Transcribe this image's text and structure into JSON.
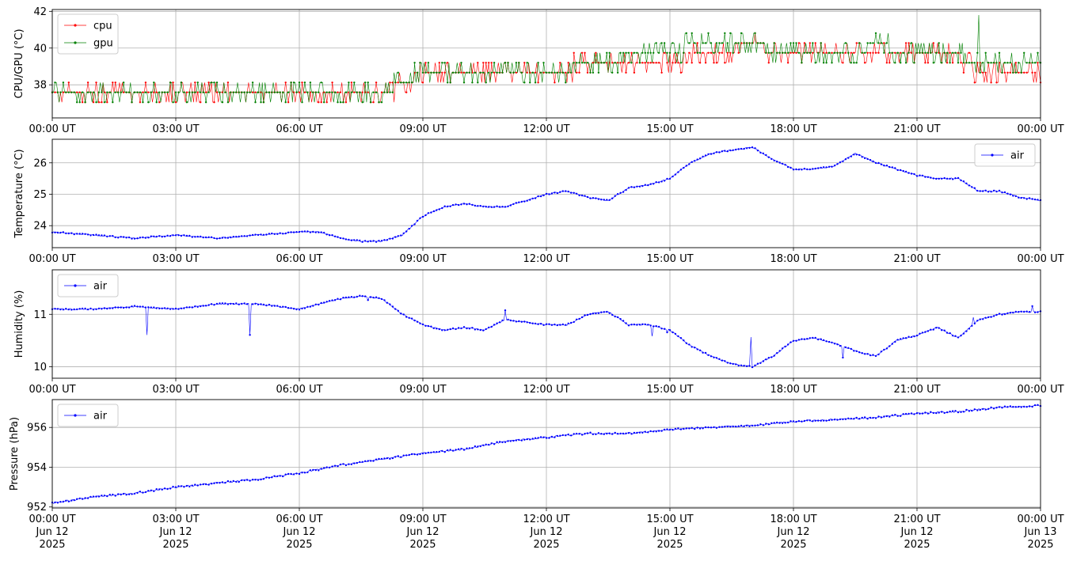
{
  "figure": {
    "x_tick_labels": [
      "00:00 UT",
      "03:00 UT",
      "06:00 UT",
      "09:00 UT",
      "12:00 UT",
      "15:00 UT",
      "18:00 UT",
      "21:00 UT",
      "00:00 UT"
    ],
    "bottom_date_lines": [
      [
        "Jun 12",
        "2025"
      ],
      [
        "Jun 12",
        "2025"
      ],
      [
        "Jun 12",
        "2025"
      ],
      [
        "Jun 12",
        "2025"
      ],
      [
        "Jun 12",
        "2025"
      ],
      [
        "Jun 12",
        "2025"
      ],
      [
        "Jun 12",
        "2025"
      ],
      [
        "Jun 12",
        "2025"
      ],
      [
        "Jun 13",
        "2025"
      ]
    ]
  },
  "chart_data": [
    {
      "type": "line",
      "ylabel": "CPU/GPU (°C)",
      "xlim": [
        "2025-06-12T00:00Z",
        "2025-06-13T00:00Z"
      ],
      "ylim": [
        36.2,
        42.1
      ],
      "yticks": [
        38,
        40,
        42
      ],
      "grid": true,
      "legend": "upper-left",
      "series": [
        {
          "name": "cpu",
          "color": "#ff0000",
          "x_hours": [
            0,
            1,
            2,
            3,
            4,
            5,
            6,
            7,
            8,
            8.5,
            9,
            10,
            11,
            12,
            13,
            14,
            15,
            15.5,
            16,
            17,
            18,
            19,
            20,
            21,
            22,
            22.5,
            23,
            24
          ],
          "values": [
            37.5,
            37.5,
            37.5,
            37.5,
            37.5,
            37.5,
            37.5,
            37.5,
            37.5,
            38.0,
            38.6,
            38.6,
            38.6,
            38.6,
            39.1,
            39.1,
            39.1,
            39.6,
            39.6,
            40.2,
            39.6,
            39.6,
            39.6,
            39.6,
            39.6,
            38.6,
            38.6,
            38.6
          ]
        },
        {
          "name": "gpu",
          "color": "#008000",
          "x_hours": [
            0,
            1,
            2,
            3,
            4,
            5,
            6,
            7,
            8,
            8.5,
            9,
            10,
            11,
            12,
            13,
            14,
            15,
            15.5,
            16,
            17,
            18,
            19,
            20,
            21,
            22,
            22.5,
            23,
            24
          ],
          "values": [
            37.6,
            37.6,
            37.6,
            37.6,
            37.6,
            37.6,
            37.6,
            37.6,
            37.6,
            38.1,
            38.6,
            38.6,
            38.6,
            38.6,
            39.1,
            39.6,
            39.6,
            40.2,
            40.2,
            40.2,
            39.6,
            39.6,
            40.2,
            39.6,
            39.6,
            39.1,
            39.1,
            39.1
          ]
        }
      ]
    },
    {
      "type": "line",
      "ylabel": "Temperature (°C)",
      "xlim": [
        "2025-06-12T00:00Z",
        "2025-06-13T00:00Z"
      ],
      "ylim": [
        23.3,
        26.75
      ],
      "yticks": [
        24,
        25,
        26
      ],
      "grid": true,
      "legend": "upper-right",
      "series": [
        {
          "name": "air",
          "color": "#0000ff",
          "x_hours": [
            0,
            1,
            2,
            3,
            4,
            5,
            6,
            6.5,
            7,
            7.5,
            8,
            8.5,
            9,
            9.5,
            10,
            10.5,
            11,
            11.5,
            12,
            12.5,
            13,
            13.5,
            14,
            14.5,
            15,
            15.5,
            16,
            16.5,
            17,
            17.5,
            18,
            18.5,
            19,
            19.5,
            20,
            20.5,
            21,
            21.5,
            22,
            22.5,
            23,
            23.5,
            24
          ],
          "values": [
            23.8,
            23.7,
            23.6,
            23.7,
            23.6,
            23.7,
            23.8,
            23.8,
            23.6,
            23.5,
            23.5,
            23.7,
            24.3,
            24.6,
            24.7,
            24.6,
            24.6,
            24.8,
            25.0,
            25.1,
            24.9,
            24.8,
            25.2,
            25.3,
            25.5,
            26.0,
            26.3,
            26.4,
            26.5,
            26.1,
            25.8,
            25.8,
            25.9,
            26.3,
            26.0,
            25.8,
            25.6,
            25.5,
            25.5,
            25.1,
            25.1,
            24.9,
            24.8
          ]
        }
      ]
    },
    {
      "type": "line",
      "ylabel": "Humidity (%)",
      "xlim": [
        "2025-06-12T00:00Z",
        "2025-06-13T00:00Z"
      ],
      "ylim": [
        9.78,
        11.85
      ],
      "yticks": [
        10,
        11
      ],
      "grid": true,
      "legend": "upper-left",
      "series": [
        {
          "name": "air",
          "color": "#0000ff",
          "x_hours": [
            0,
            1,
            2,
            3,
            4,
            5,
            6,
            6.5,
            7,
            7.5,
            8,
            8.5,
            9,
            9.5,
            10,
            10.5,
            11,
            11.5,
            12,
            12.5,
            13,
            13.5,
            14,
            14.5,
            15,
            15.5,
            16,
            16.5,
            17,
            17.5,
            18,
            18.5,
            19,
            19.5,
            20,
            20.5,
            21,
            21.5,
            22,
            22.5,
            23,
            23.5,
            24
          ],
          "values": [
            11.1,
            11.1,
            11.15,
            11.1,
            11.2,
            11.2,
            11.1,
            11.2,
            11.3,
            11.35,
            11.3,
            11.0,
            10.8,
            10.7,
            10.75,
            10.7,
            10.9,
            10.85,
            10.8,
            10.8,
            11.0,
            11.05,
            10.8,
            10.8,
            10.7,
            10.4,
            10.2,
            10.05,
            10.0,
            10.2,
            10.5,
            10.55,
            10.45,
            10.3,
            10.2,
            10.5,
            10.6,
            10.75,
            10.55,
            10.9,
            11.0,
            11.05,
            11.05
          ]
        }
      ]
    },
    {
      "type": "line",
      "ylabel": "Pressure (hPa)",
      "xlim": [
        "2025-06-12T00:00Z",
        "2025-06-13T00:00Z"
      ],
      "ylim": [
        951.95,
        957.4
      ],
      "yticks": [
        952,
        954,
        956
      ],
      "grid": true,
      "legend": "upper-left",
      "series": [
        {
          "name": "air",
          "color": "#0000ff",
          "x_hours": [
            0,
            1,
            2,
            3,
            4,
            5,
            6,
            7,
            8,
            9,
            10,
            11,
            12,
            13,
            14,
            15,
            16,
            17,
            18,
            19,
            20,
            21,
            22,
            23,
            24
          ],
          "values": [
            952.2,
            952.5,
            952.7,
            953.0,
            953.2,
            953.4,
            953.7,
            954.1,
            954.4,
            954.7,
            954.9,
            955.3,
            955.5,
            955.7,
            955.7,
            955.9,
            956.0,
            956.1,
            956.3,
            956.4,
            956.5,
            956.7,
            956.8,
            957.0,
            957.1
          ]
        }
      ]
    }
  ]
}
